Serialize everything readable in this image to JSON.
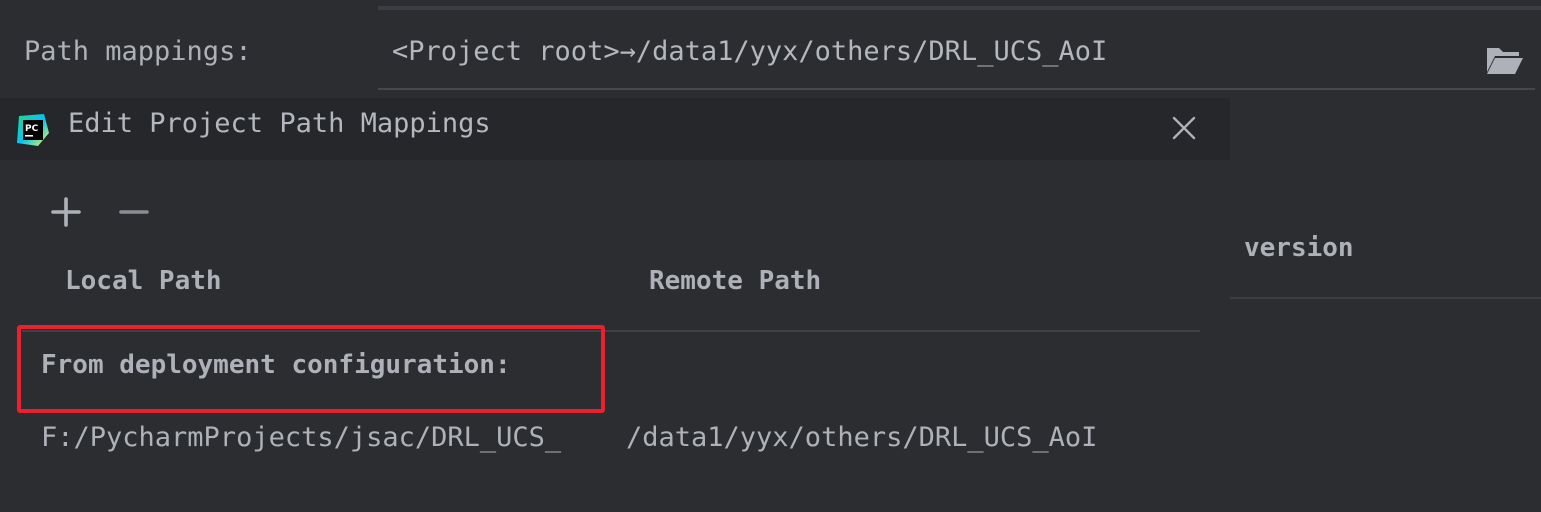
{
  "background": {
    "path_mappings_label": "Path mappings:",
    "path_mappings_value": "<Project root>→/data1/yyx/others/DRL_UCS_AoI",
    "folder_icon": "folder-open-icon",
    "version_header": "version"
  },
  "dialog": {
    "app_icon": "pycharm-logo",
    "app_icon_text": "PC",
    "title": "Edit Project Path Mappings",
    "close_icon": "close-icon",
    "toolbar": {
      "add_label": "+",
      "remove_label": "−"
    },
    "columns": {
      "local": "Local Path",
      "remote": "Remote Path"
    },
    "group_label": "From deployment configuration:",
    "mappings": [
      {
        "local": "F:/PycharmProjects/jsac/DRL_UCS_",
        "remote": "/data1/yyx/others/DRL_UCS_AoI"
      }
    ]
  },
  "colors": {
    "background": "#2b2d30",
    "header": "#25272a",
    "text": "#aeb2b8",
    "highlight": "#e8212d"
  }
}
